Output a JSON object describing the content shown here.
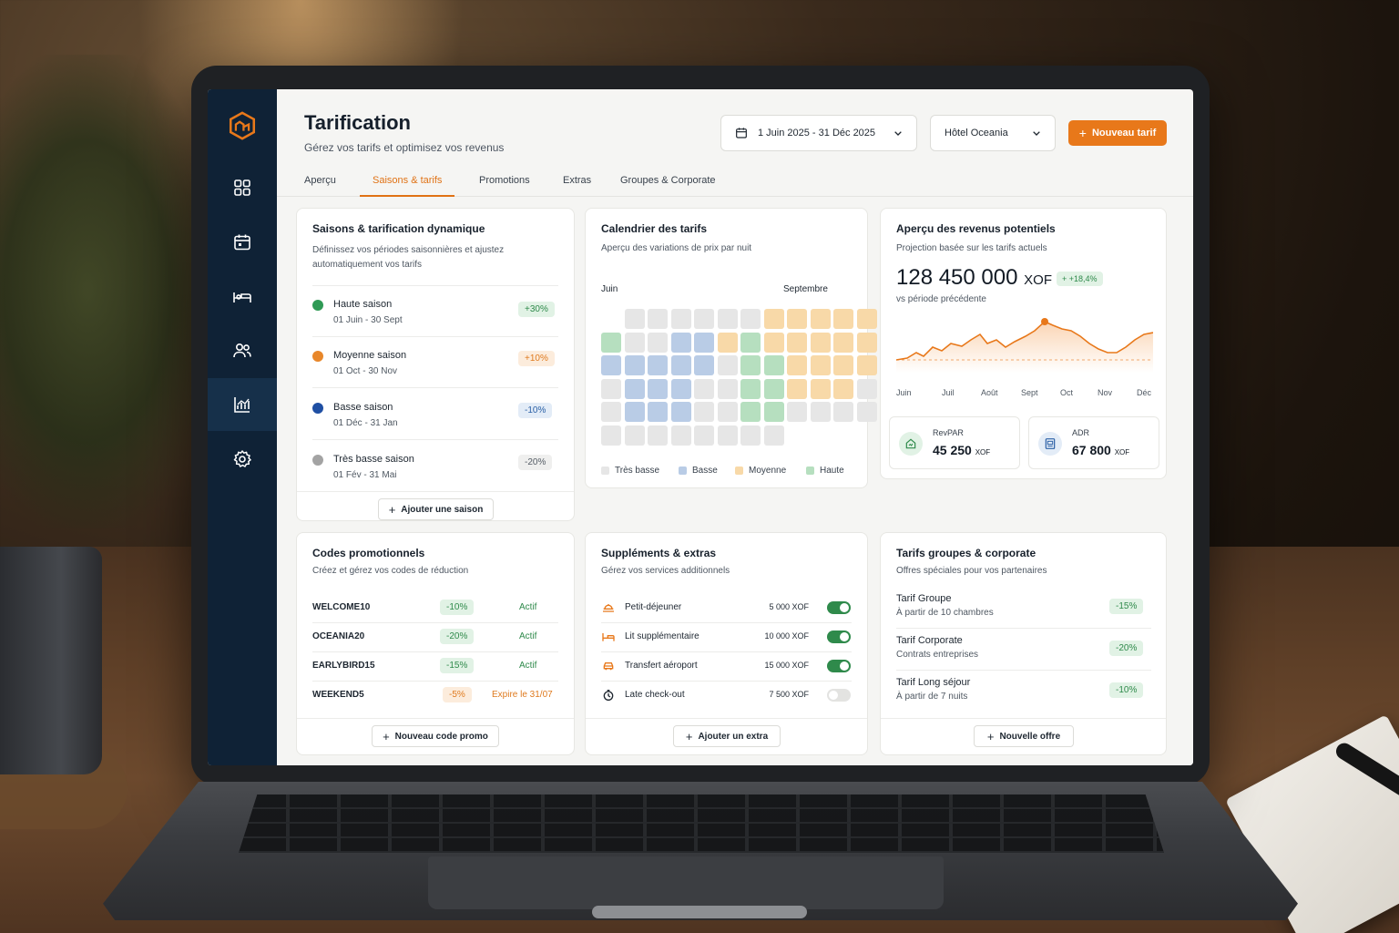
{
  "header": {
    "title": "Tarification",
    "subtitle": "Gérez vos tarifs et optimisez vos revenus",
    "date_range": "1 Juin 2025 - 31 Déc 2025",
    "hotel": "Hôtel Oceania",
    "new_rate_label": "Nouveau tarif"
  },
  "tabs": [
    {
      "label": "Aperçu"
    },
    {
      "label": "Saisons & tarifs",
      "active": true
    },
    {
      "label": "Promotions"
    },
    {
      "label": "Extras"
    },
    {
      "label": "Groupes & Corporate"
    }
  ],
  "seasons": {
    "title": "Saisons & tarification dynamique",
    "subtitle": "Définissez vos périodes saisonnières et ajustez automatiquement vos tarifs",
    "items": [
      {
        "name": "Haute saison",
        "dates": "01 Juin - 30 Sept",
        "delta": "+30%",
        "color": "#2f9a55"
      },
      {
        "name": "Moyenne saison",
        "dates": "01 Oct - 30 Nov",
        "delta": "+10%",
        "color": "#e8872a"
      },
      {
        "name": "Basse saison",
        "dates": "01 Déc - 31 Jan",
        "delta": "-10%",
        "color": "#1f4fa3"
      },
      {
        "name": "Très basse saison",
        "dates": "01 Fév - 31 Mai",
        "delta": "-20%",
        "color": "#a3a3a3"
      }
    ],
    "add_label": "Ajouter une saison"
  },
  "calendar": {
    "title": "Calendrier des tarifs",
    "subtitle": "Aperçu des variations de prix par nuit",
    "month_left": "Juin",
    "month_right": "Septembre",
    "legend": [
      "Très basse",
      "Basse",
      "Moyenne",
      "Haute"
    ],
    "colors": {
      "very_low": "#e6e6e6",
      "low": "#b9cce6",
      "medium": "#f8d9a8",
      "high": "#b6dfbf"
    }
  },
  "revenue": {
    "title": "Aperçu des revenus potentiels",
    "subtitle": "Projection basée sur les tarifs actuels",
    "amount": "128 450 000",
    "currency": "XOF",
    "delta": "+ +18,4%",
    "comparison": "vs période précédente",
    "months": [
      "Juin",
      "Juil",
      "Août",
      "Sept",
      "Oct",
      "Nov",
      "Déc"
    ],
    "revpar_label": "RevPAR",
    "revpar_value": "45 250",
    "adr_label": "ADR",
    "adr_value": "67 800",
    "kpi_currency": "XOF",
    "accent": "#e8781a"
  },
  "promos": {
    "title": "Codes promotionnels",
    "subtitle": "Créez et gérez vos codes de réduction",
    "items": [
      {
        "code": "WELCOME10",
        "discount": "-10%",
        "status": "Actif"
      },
      {
        "code": "OCEANIA20",
        "discount": "-20%",
        "status": "Actif"
      },
      {
        "code": "EARLYBIRD15",
        "discount": "-15%",
        "status": "Actif"
      },
      {
        "code": "WEEKEND5",
        "discount": "-5%",
        "status": "Expire le 31/07"
      }
    ],
    "add_label": "Nouveau code promo"
  },
  "extras": {
    "title": "Suppléments & extras",
    "subtitle": "Gérez vos services additionnels",
    "items": [
      {
        "name": "Petit-déjeuner",
        "price": "5 000 XOF",
        "enabled": true,
        "icon": "breakfast-icon"
      },
      {
        "name": "Lit supplémentaire",
        "price": "10 000 XOF",
        "enabled": true,
        "icon": "bed-icon"
      },
      {
        "name": "Transfert aéroport",
        "price": "15 000 XOF",
        "enabled": true,
        "icon": "car-icon"
      },
      {
        "name": "Late check-out",
        "price": "7 500 XOF",
        "enabled": false,
        "icon": "clock-icon"
      }
    ],
    "add_label": "Ajouter un extra"
  },
  "groups": {
    "title": "Tarifs groupes & corporate",
    "subtitle": "Offres spéciales pour vos partenaires",
    "items": [
      {
        "name": "Tarif Groupe",
        "desc": "À partir de 10 chambres",
        "discount": "-15%"
      },
      {
        "name": "Tarif Corporate",
        "desc": "Contrats entreprises",
        "discount": "-20%"
      },
      {
        "name": "Tarif Long séjour",
        "desc": "À partir de 7 nuits",
        "discount": "-10%"
      }
    ],
    "add_label": "Nouvelle offre"
  },
  "sidebar": {
    "icons": [
      "logo-icon",
      "dashboard-icon",
      "calendar-icon",
      "bed-icon",
      "users-icon",
      "analytics-icon",
      "settings-icon"
    ]
  }
}
